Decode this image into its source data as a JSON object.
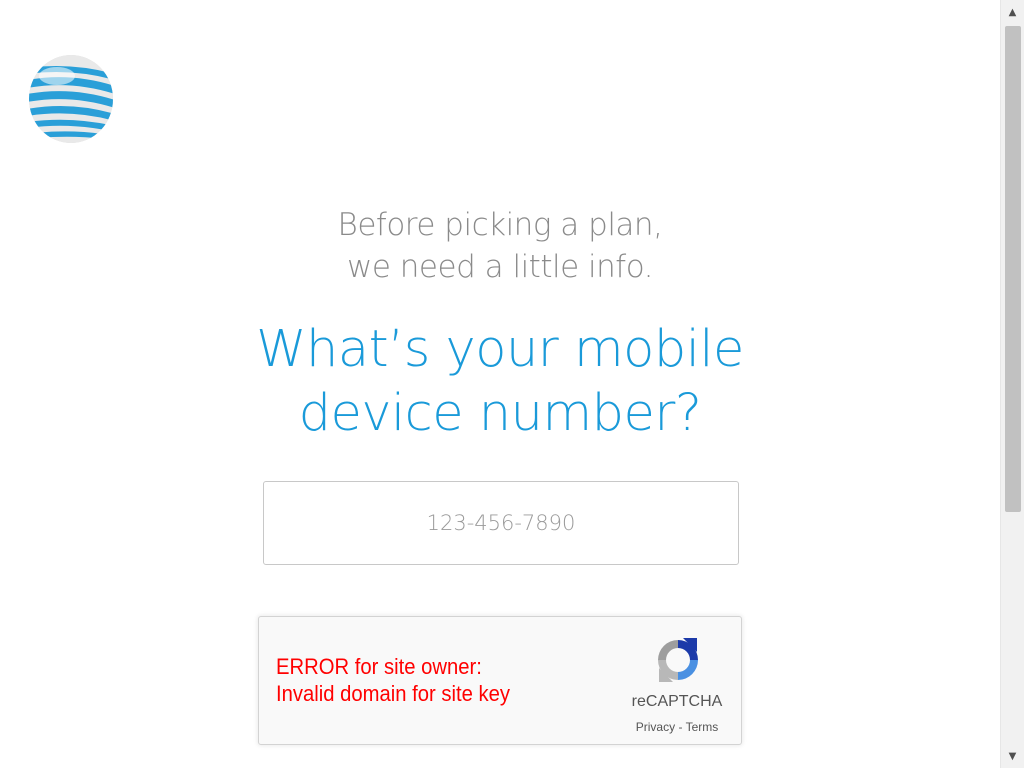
{
  "brand": {
    "logo_icon": "att-globe-icon",
    "color": "#1a9ad9"
  },
  "intro": {
    "line1": "Before picking a plan,",
    "line2": "we need a little info."
  },
  "question": {
    "line1": "What’s your mobile",
    "line2": "device number?"
  },
  "phone_field": {
    "placeholder": "123-456-7890",
    "value": ""
  },
  "recaptcha": {
    "error_line1": "ERROR for site owner:",
    "error_line2": "Invalid domain for site key",
    "brand": "reCAPTCHA",
    "privacy": "Privacy",
    "separator": " - ",
    "terms": "Terms",
    "error_color": "#ff0000"
  },
  "scrollbar": {
    "up_icon": "arrow-up-icon",
    "down_icon": "arrow-down-icon"
  }
}
